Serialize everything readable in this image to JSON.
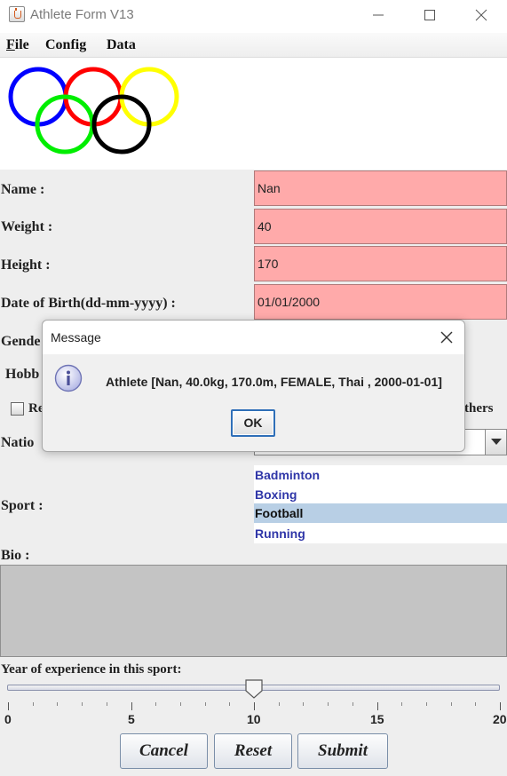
{
  "window": {
    "title": "Athlete Form V13",
    "controls": {
      "minimize": "minimize-icon",
      "maximize": "maximize-icon",
      "close": "close-icon"
    }
  },
  "menu": [
    {
      "mnemonic": "F",
      "rest": "ile"
    },
    {
      "mnemonic": "",
      "rest": "Config"
    },
    {
      "mnemonic": "",
      "rest": "Data"
    }
  ],
  "logo": {
    "name": "olympic-rings",
    "colors": [
      "#0000ff",
      "#ff0000",
      "#ffff00",
      "#00ee00",
      "#000000"
    ]
  },
  "form": {
    "name_label": "Name :",
    "name_value": "Nan",
    "weight_label": "Weight :",
    "weight_value": "40",
    "height_label": "Height :",
    "height_value": "170",
    "dob_label": "Date of Birth(dd-mm-yyyy) :",
    "dob_value": "01/01/2000",
    "gender_label_partial": "Gende",
    "hobbies_label_partial": "Hobb",
    "hobby_checkbox_partial": "Re",
    "hobby_others_partial": "thers",
    "nationality_label_partial": "Natio",
    "sport_label": "Sport :",
    "sports": [
      "Badminton",
      "Boxing",
      "Football",
      "Running"
    ],
    "sport_selected": "Football",
    "bio_label": "Bio :",
    "experience_label": "Year of experience in this sport:",
    "slider": {
      "min": 0,
      "max": 20,
      "value": 10,
      "major_ticks": [
        "0",
        "5",
        "10",
        "15",
        "20"
      ]
    },
    "field_color": "#ffaaaa"
  },
  "buttons": {
    "cancel": "Cancel",
    "reset": "Reset",
    "submit": "Submit"
  },
  "dialog": {
    "title": "Message",
    "message": "Athlete [Nan, 40.0kg, 170.0m, FEMALE, Thai , 2000-01-01]",
    "ok": "OK",
    "icon": "info-icon",
    "close_icon": "close-icon"
  }
}
